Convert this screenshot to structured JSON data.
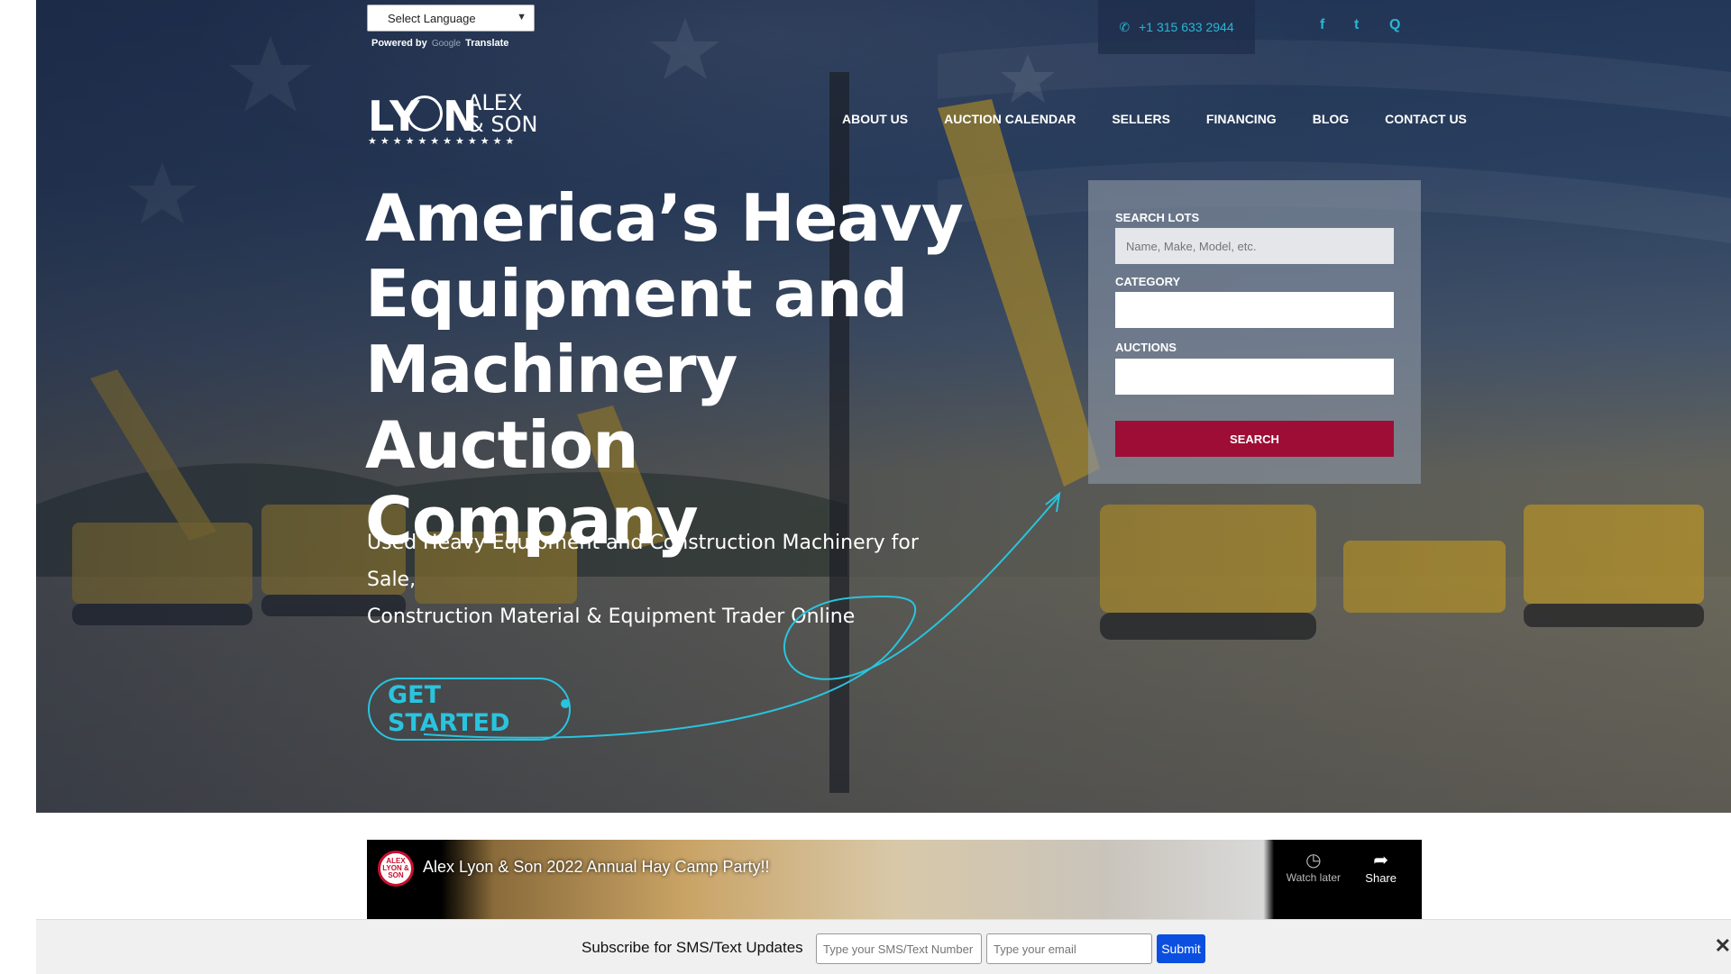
{
  "top_bar": {
    "language_select": "Select Language",
    "powered_by": "Powered by",
    "google": "Google",
    "translate": "Translate",
    "phone": "+1 315 633 2944",
    "facebook_glyph": "f",
    "twitter_glyph": "t",
    "search_glyph": "Q"
  },
  "logo": {
    "ly": "LY",
    "n": "N",
    "alex": "ALEX",
    "son": "& SON",
    "stars": "★★★★★★★★★★★★"
  },
  "nav": {
    "items": [
      "ABOUT US",
      "AUCTION CALENDAR",
      "SELLERS",
      "FINANCING",
      "BLOG",
      "CONTACT US"
    ]
  },
  "hero": {
    "headline": [
      "America’s Heavy",
      "Equipment and",
      "Machinery Auction",
      "Company"
    ],
    "subtitle_line1": "Used Heavy Equipment and Construction Machinery for Sale,",
    "subtitle_line2": "Construction Material & Equipment Trader Online",
    "cta": "GET STARTED"
  },
  "search_panel": {
    "search_lots_label": "SEARCH LOTS",
    "search_lots_placeholder": "Name, Make, Model, etc.",
    "category_label": "CATEGORY",
    "auctions_label": "AUCTIONS",
    "search_button": "SEARCH"
  },
  "video": {
    "title": "Alex Lyon & Son 2022 Annual Hay Camp Party!!",
    "channel_logo": "ALEX LYON & SON",
    "watch_later": "Watch later",
    "share": "Share"
  },
  "sms_bar": {
    "label": "Subscribe for SMS/Text Updates",
    "phone_placeholder": "Type your SMS/Text Number",
    "email_placeholder": "Type your email",
    "submit": "Submit",
    "close": "✕"
  },
  "colors": {
    "accent_cyan": "#29c4de",
    "search_button": "#9e0d35",
    "submit_blue": "#0a4fe0"
  }
}
